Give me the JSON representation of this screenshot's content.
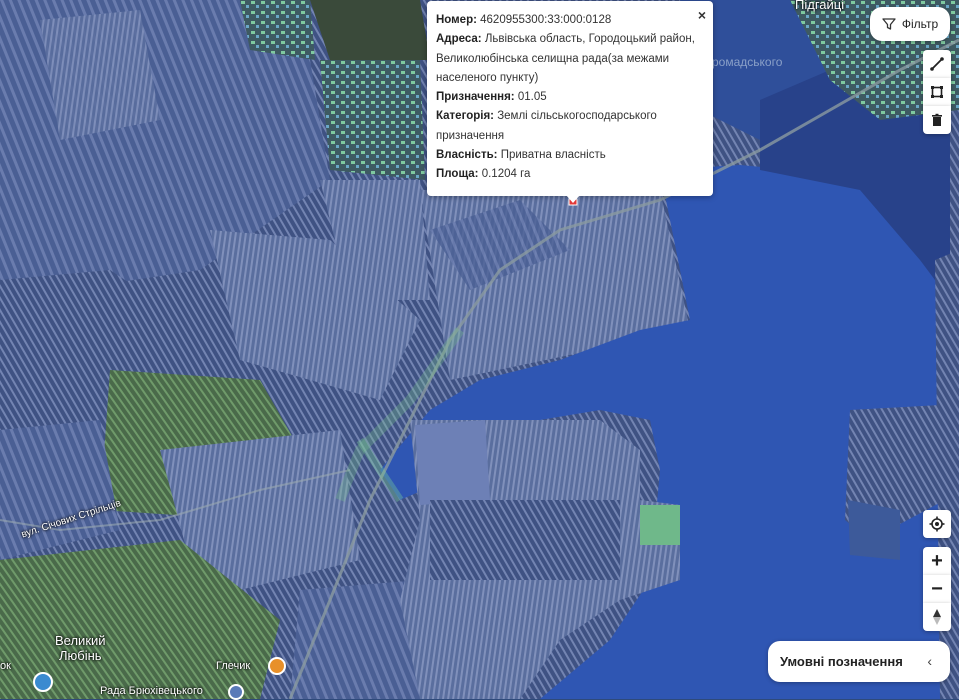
{
  "popup": {
    "close": "×",
    "fields": [
      {
        "label": "Номер:",
        "value": "4620955300:33:000:0128"
      },
      {
        "label": "Адреса:",
        "value": "Львівська область, Городоцький район, Великолюбінська селищна рада(за межами населеного пункту)"
      },
      {
        "label": "Призначення:",
        "value": "01.05"
      },
      {
        "label": "Категорія:",
        "value": "Землі сільськогосподарського призначення"
      },
      {
        "label": "Власність:",
        "value": "Приватна власність"
      },
      {
        "label": "Площа:",
        "value": "0.1204 га"
      }
    ]
  },
  "toolbar": {
    "filter_label": "Фільтр",
    "tools": [
      "line-tool-icon",
      "polygon-tool-icon",
      "trash-icon"
    ]
  },
  "controls": {
    "locate": "locate-icon",
    "zoom_in": "+",
    "zoom_out": "−"
  },
  "legend": {
    "label": "Умовні позначення",
    "chevron": "‹"
  },
  "map_labels": {
    "town": "Великий Любінь",
    "town_line1": "Великий",
    "town_line2": "Любінь",
    "street": "вул. Січових Стрільців",
    "village_top": "Підгайці",
    "hromada": "ромадського",
    "lake": "Глечик",
    "bottom": "Рада Брюхівецького",
    "left_edge": "ок"
  },
  "colors": {
    "cadastre_fill": "#3a5fb8",
    "water_blue": "#2e55b0",
    "field_green": "#5a7a3a",
    "parcel_green": "#6fd39a"
  }
}
